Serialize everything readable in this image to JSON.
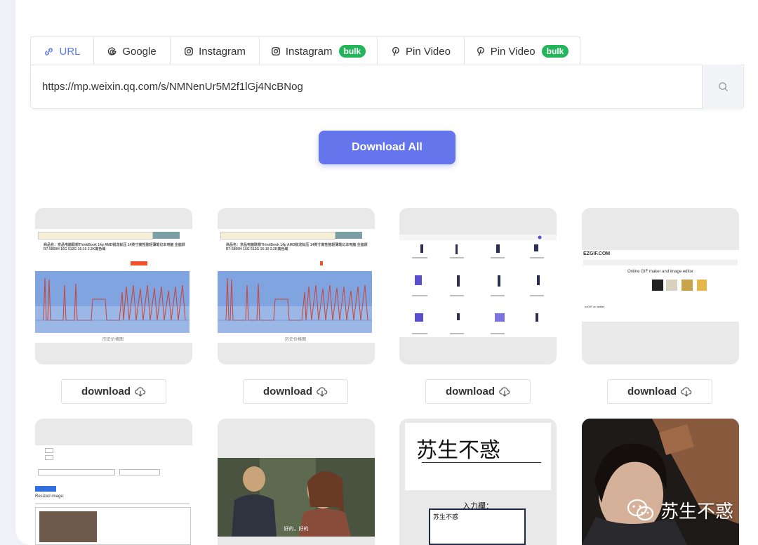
{
  "tabs": [
    {
      "label": "URL",
      "icon": "link-icon",
      "active": true
    },
    {
      "label": "Google",
      "icon": "google-icon",
      "active": false
    },
    {
      "label": "Instagram",
      "icon": "instagram-icon",
      "active": false
    },
    {
      "label": "Instagram",
      "icon": "instagram-icon",
      "badge": "bulk",
      "active": false
    },
    {
      "label": "Pin Video",
      "icon": "pinterest-icon",
      "active": false
    },
    {
      "label": "Pin Video",
      "icon": "pinterest-icon",
      "badge": "bulk",
      "active": false
    }
  ],
  "url_input": {
    "value": "https://mp.weixin.qq.com/s/NMNenUr5M2f1lGj4NcBNog"
  },
  "download_all_label": "Download All",
  "download_label": "download",
  "cards": {
    "c1": {
      "title": "商品名：京品电脑联想ThinkBook 14p AMD锐龙标压 14英寸高性能轻薄笔记本电脑 全面屏 R7-5800H 16G 512G 16:10 2.2K高色域",
      "caption": "历史价格图"
    },
    "c2": {
      "title": "商品名：京品电脑联想ThinkBook 14p AMD锐龙标压 14英寸高性能轻薄笔记本电脑 全面屏 R7-5800H 16G 512G 16:10 2.2K高色域",
      "caption": "历史价格图"
    },
    "c4": {
      "heading": "Online GIF maker and image editor",
      "logo": "EZGIF.COM",
      "subheading": "ezGIF on twitter"
    },
    "c5": {
      "resized_label": "Resized image:"
    },
    "c6": {
      "subtitle": "好的，好的"
    },
    "c7": {
      "big_text": "苏生不惑",
      "input_label": "入力欄：",
      "input_value": "苏生不惑"
    }
  },
  "watermark": "苏生不惑",
  "colors": {
    "accent": "#6576ec",
    "badge": "#22b55a",
    "active_tab": "#5b7be6"
  }
}
